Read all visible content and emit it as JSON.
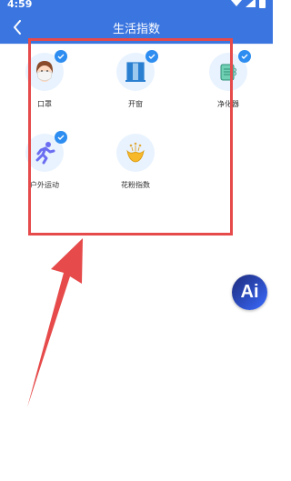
{
  "status_bar": {
    "time": "4:59"
  },
  "header": {
    "title": "生活指数"
  },
  "items": [
    {
      "label": "口罩",
      "icon": "mask-face-icon",
      "checked": true
    },
    {
      "label": "开窗",
      "icon": "window-icon",
      "checked": true
    },
    {
      "label": "净化器",
      "icon": "air-purifier-icon",
      "checked": true
    },
    {
      "label": "户外运动",
      "icon": "running-person-icon",
      "checked": true
    },
    {
      "label": "花粉指数",
      "icon": "flower-pollen-icon",
      "checked": false
    }
  ],
  "floating_button": {
    "label": "Ai"
  },
  "colors": {
    "header_bg": "#3b76e0",
    "check_blue": "#2e8df0",
    "highlight_red": "#e64a4a"
  }
}
